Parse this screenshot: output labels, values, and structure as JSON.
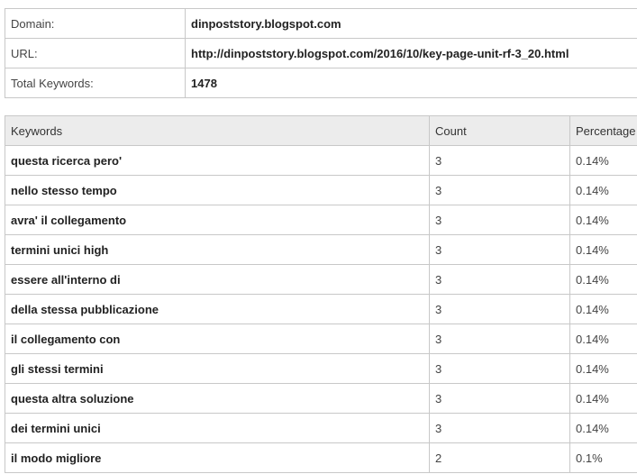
{
  "info": {
    "domain_label": "Domain:",
    "domain_value": "dinpoststory.blogspot.com",
    "url_label": "URL:",
    "url_value": "http://dinpoststory.blogspot.com/2016/10/key-page-unit-rf-3_20.html",
    "total_label": "Total Keywords:",
    "total_value": "1478"
  },
  "keywords_table": {
    "headers": {
      "keywords": "Keywords",
      "count": "Count",
      "percentage": "Percentage"
    },
    "rows": [
      {
        "keyword": "questa ricerca pero'",
        "count": "3",
        "percentage": "0.14%"
      },
      {
        "keyword": "nello stesso tempo",
        "count": "3",
        "percentage": "0.14%"
      },
      {
        "keyword": "avra' il collegamento",
        "count": "3",
        "percentage": "0.14%"
      },
      {
        "keyword": "termini unici high",
        "count": "3",
        "percentage": "0.14%"
      },
      {
        "keyword": "essere all'interno di",
        "count": "3",
        "percentage": "0.14%"
      },
      {
        "keyword": "della stessa pubblicazione",
        "count": "3",
        "percentage": "0.14%"
      },
      {
        "keyword": "il collegamento con",
        "count": "3",
        "percentage": "0.14%"
      },
      {
        "keyword": "gli stessi termini",
        "count": "3",
        "percentage": "0.14%"
      },
      {
        "keyword": "questa altra soluzione",
        "count": "3",
        "percentage": "0.14%"
      },
      {
        "keyword": "dei termini unici",
        "count": "3",
        "percentage": "0.14%"
      },
      {
        "keyword": "il modo migliore",
        "count": "2",
        "percentage": "0.1%"
      }
    ]
  }
}
